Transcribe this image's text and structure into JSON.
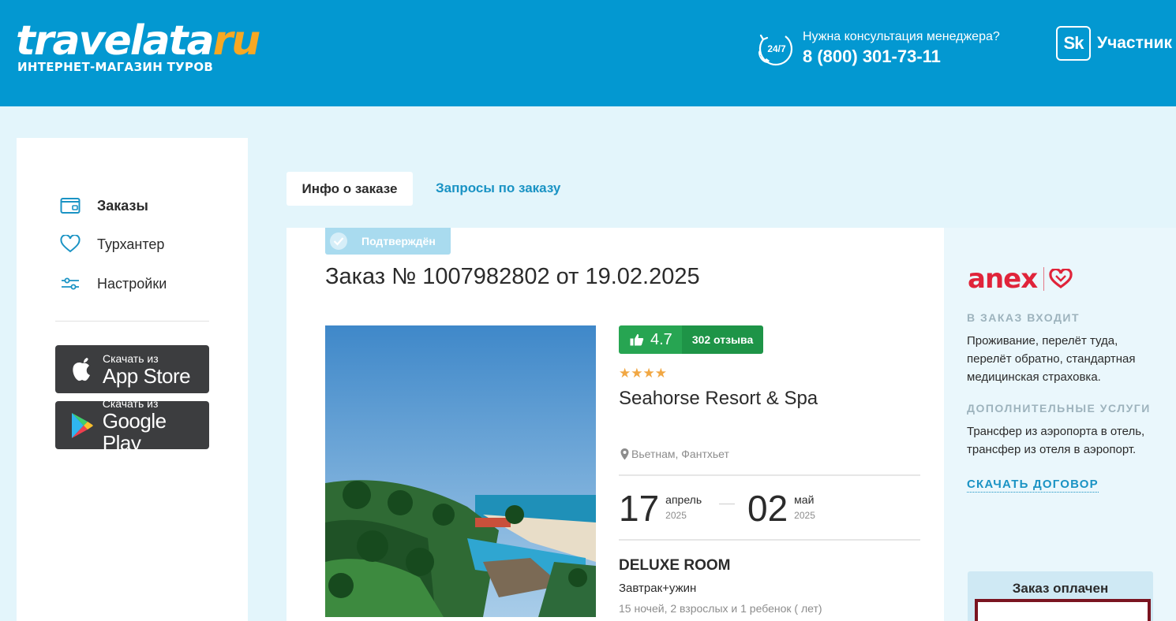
{
  "header": {
    "logo_main": "travelata",
    "logo_ru": "ru",
    "logo_sub": "ИНТЕРНЕТ-МАГАЗИН ТУРОВ",
    "support_badge": "24/7",
    "support_question": "Нужна консультация менеджера?",
    "support_phone": "8 (800) 301-73-11",
    "sk_badge": "Sk",
    "sk_label": "Участник",
    "colors": {
      "background": "#0398d1",
      "logo_accent": "#f7a823"
    }
  },
  "sidebar": {
    "items": [
      {
        "label": "Заказы",
        "icon": "wallet-icon",
        "active": true
      },
      {
        "label": "Турхантер",
        "icon": "heart-icon",
        "active": false
      },
      {
        "label": "Настройки",
        "icon": "sliders-icon",
        "active": false
      }
    ],
    "app_store": {
      "small": "Скачать из",
      "big": "App Store",
      "icon": "apple-icon"
    },
    "google_play": {
      "small": "Скачать из",
      "big": "Google Play",
      "icon": "google-play-icon"
    }
  },
  "tabs": [
    {
      "label": "Инфо о заказе",
      "active": true
    },
    {
      "label": "Запросы по заказу",
      "active": false
    }
  ],
  "order": {
    "status": "Подтверждён",
    "title": "Заказ № 1007982802 от 19.02.2025",
    "rating": "4.7",
    "reviews": "302 отзыва",
    "stars": "★★★★",
    "star_count": 4,
    "hotel_name": "Seahorse Resort & Spa",
    "location": "Вьетнам, Фантхьет",
    "date_from": {
      "day": "17",
      "month": "апрель",
      "year": "2025"
    },
    "date_to": {
      "day": "02",
      "month": "май",
      "year": "2025"
    },
    "room": "DELUXE ROOM",
    "meal": "Завтрак+ужин",
    "nights": "15 ночей, 2 взрослых и 1 ребенок ( лет)"
  },
  "right_panel": {
    "operator": "anex",
    "included_label": "В ЗАКАЗ ВХОДИТ",
    "included_text": "Проживание, перелёт туда, перелёт обратно, стандартная медицинская страховка.",
    "extra_label": "ДОПОЛНИТЕЛЬНЫЕ УСЛУГИ",
    "extra_text": "Трансфер из аэропорта в отель, трансфер из отеля в аэропорт.",
    "download_link": "СКАЧАТЬ ДОГОВОР",
    "paid_label": "Заказ оплачен",
    "colors": {
      "operator_red": "#e0243a",
      "link": "#1a93c4"
    }
  }
}
